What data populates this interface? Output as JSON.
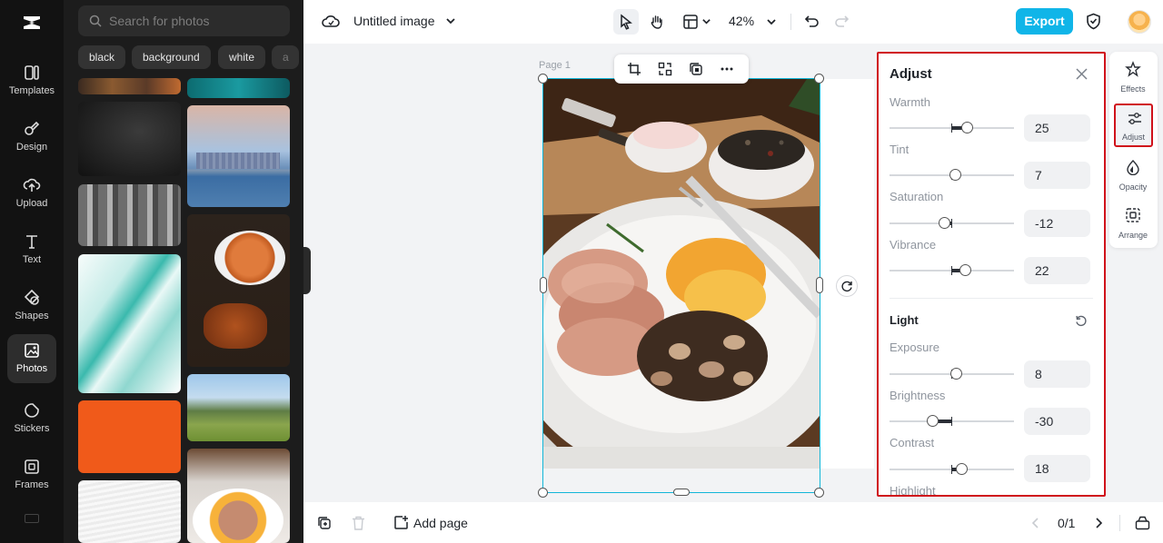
{
  "nav": {
    "items": [
      {
        "label": "Templates",
        "icon": "templates-icon"
      },
      {
        "label": "Design",
        "icon": "design-icon"
      },
      {
        "label": "Upload",
        "icon": "upload-icon"
      },
      {
        "label": "Text",
        "icon": "text-icon"
      },
      {
        "label": "Shapes",
        "icon": "shapes-icon"
      },
      {
        "label": "Photos",
        "icon": "photos-icon",
        "active": true
      },
      {
        "label": "Stickers",
        "icon": "stickers-icon"
      },
      {
        "label": "Frames",
        "icon": "frames-icon"
      }
    ]
  },
  "photos_panel": {
    "search_placeholder": "Search for photos",
    "chips": [
      "black",
      "background",
      "white",
      "a"
    ]
  },
  "topbar": {
    "title": "Untitled image",
    "zoom": "42%",
    "export_label": "Export"
  },
  "canvas": {
    "page_label": "Page 1"
  },
  "adjust": {
    "title": "Adjust",
    "light_title": "Light",
    "sliders": [
      {
        "label": "Warmth",
        "value": "25"
      },
      {
        "label": "Tint",
        "value": "7"
      },
      {
        "label": "Saturation",
        "value": "-12"
      },
      {
        "label": "Vibrance",
        "value": "22"
      },
      {
        "label": "Exposure",
        "value": "8"
      },
      {
        "label": "Brightness",
        "value": "-30"
      },
      {
        "label": "Contrast",
        "value": "18"
      },
      {
        "label": "Highlight",
        "value": ""
      }
    ]
  },
  "right_tabs": [
    {
      "label": "Effects",
      "icon": "effects-icon"
    },
    {
      "label": "Adjust",
      "icon": "adjust-icon",
      "active": true
    },
    {
      "label": "Opacity",
      "icon": "opacity-icon"
    },
    {
      "label": "Arrange",
      "icon": "arrange-icon"
    }
  ],
  "bottombar": {
    "add_page": "Add page",
    "page_counter": "0/1"
  },
  "colors": {
    "accent": "#10b5e8",
    "selection": "#11b6d8",
    "highlight_box": "#d0121b"
  }
}
